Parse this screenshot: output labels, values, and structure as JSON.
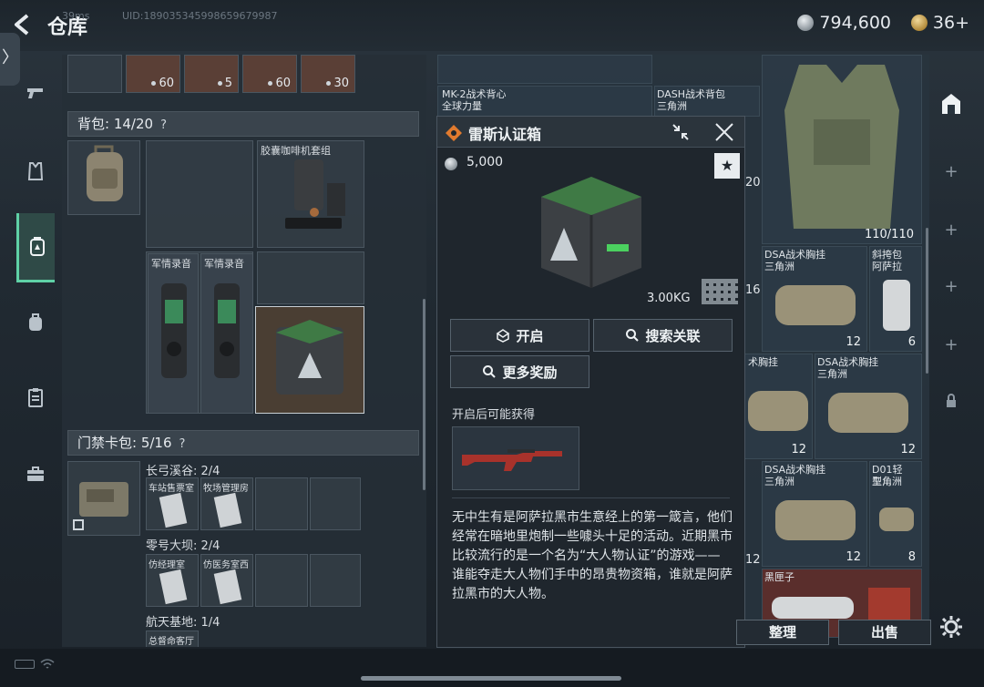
{
  "header": {
    "title": "仓库",
    "currency_value": "794,600",
    "tickets_value": "36+",
    "side_tab_glyph": "〉"
  },
  "left_nav": {
    "icons": [
      "pistol-icon",
      "vest-icon",
      "backpack-safe-icon",
      "backpack-icon",
      "clipboard-icon",
      "toolbox-icon"
    ],
    "active_index": 2
  },
  "stash_top_row": {
    "quantities": [
      "60",
      "5",
      "60",
      "30"
    ]
  },
  "backpack": {
    "header": "背包: 14/20",
    "help": "?",
    "items": [
      {
        "name": "胶囊咖啡机套组"
      },
      {
        "name": "军情录音"
      },
      {
        "name": "军情录音"
      }
    ]
  },
  "keycard_bag": {
    "header": "门禁卡包: 5/16",
    "help": "?",
    "groups": [
      {
        "title": "长弓溪谷: 2/4",
        "cards": [
          "车站售票室",
          "牧场管理房"
        ]
      },
      {
        "title": "零号大坝: 2/4",
        "cards": [
          "仿经理室",
          "仿医务室西"
        ]
      },
      {
        "title": "航天基地: 1/4",
        "cards": [
          "总督命客厅"
        ]
      }
    ]
  },
  "inventory": {
    "items": [
      {
        "name": "MK-2战术背心",
        "sub": "全球力量"
      },
      {
        "name": "DASH战术背包",
        "sub": "三角洲"
      },
      {
        "name": "",
        "sub": "",
        "qty": "110/110"
      },
      {
        "name": "DSA战术胸挂",
        "sub": "三角洲",
        "qty": "12"
      },
      {
        "name": "斜挎包",
        "sub": "阿萨拉",
        "qty": "6"
      },
      {
        "name": "术胸挂",
        "sub": "",
        "qty": "12"
      },
      {
        "name": "DSA战术胸挂",
        "sub": "三角洲",
        "qty": "12"
      },
      {
        "name": "DSA战术胸挂",
        "sub": "三角洲",
        "qty": "12"
      },
      {
        "name": "D01轻型…",
        "sub": "三角洲",
        "qty": "8"
      },
      {
        "name": "黑匣子",
        "sub": ""
      }
    ],
    "partial_labels": [
      "20",
      "16",
      "12"
    ]
  },
  "right_bar": {
    "items": [
      "safe-icon",
      "+",
      "+",
      "+",
      "+",
      "lock-icon"
    ]
  },
  "popup": {
    "title": "雷斯认证箱",
    "price": "5,000",
    "weight": "3.00KG",
    "buttons": {
      "open": "开启",
      "search_related": "搜索关联",
      "more_rewards": "更多奖励"
    },
    "possible_label": "开启后可能获得",
    "description": "无中生有是阿萨拉黑市生意经上的第一箴言，他们经常在暗地里炮制一些噱头十足的活动。近期黑市比较流行的是一个名为“大人物认证”的游戏——谁能夺走大人物们手中的昂贵物资箱，谁就是阿萨拉黑市的大人物。"
  },
  "bottom": {
    "organize": "整理",
    "sell": "出售",
    "ping": "39ms",
    "uid": "UID:189035345998659679987"
  },
  "colors": {
    "accent_green": "#5fd1a6",
    "popup_bg": "#1f262d",
    "crate_green": "#3f7a45"
  }
}
